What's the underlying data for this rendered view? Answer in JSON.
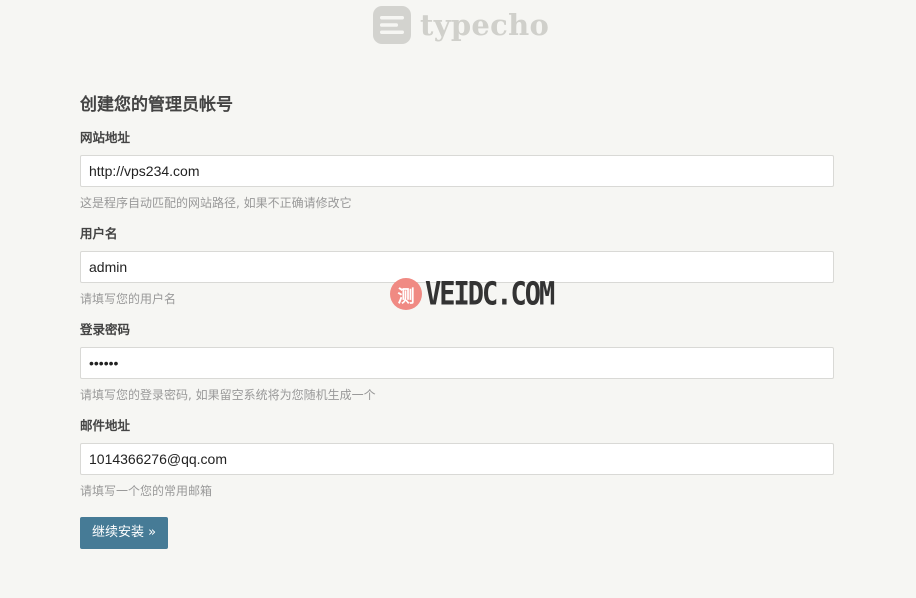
{
  "header": {
    "logo_text": "typecho"
  },
  "form": {
    "title": "创建您的管理员帐号",
    "fields": [
      {
        "label": "网站地址",
        "value": "http://vps234.com",
        "description": "这是程序自动匹配的网站路径, 如果不正确请修改它"
      },
      {
        "label": "用户名",
        "value": "admin",
        "description": "请填写您的用户名"
      },
      {
        "label": "登录密码",
        "value": "123456",
        "description": "请填写您的登录密码, 如果留空系统将为您随机生成一个"
      },
      {
        "label": "邮件地址",
        "value": "1014366276@qq.com",
        "description": "请填写一个您的常用邮箱"
      }
    ],
    "submit_label": "继续安装 »"
  },
  "watermark": {
    "badge": "测",
    "text": "VEIDC.COM"
  },
  "colors": {
    "background": "#f6f6f3",
    "button": "#467b96",
    "watermark_badge": "#f08a83"
  },
  "icons": {
    "logo": "typecho-logo-icon"
  }
}
